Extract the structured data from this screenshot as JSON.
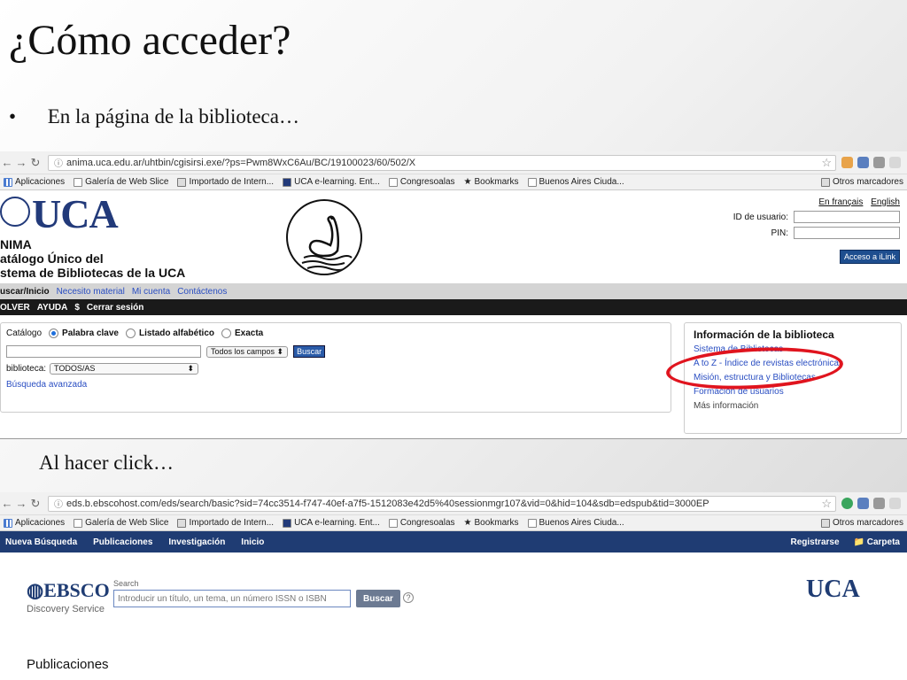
{
  "slide": {
    "title": "¿Cómo acceder?",
    "bullet": "En la página de la biblioteca…",
    "caption": "Al hacer click…"
  },
  "browser1": {
    "url": "anima.uca.edu.ar/uhtbin/cgisirsi.exe/?ps=Pwm8WxC6Au/BC/19100023/60/502/X",
    "bookmarks": [
      "Aplicaciones",
      "Galería de Web Slice",
      "Importado de Intern...",
      "UCA e-learning. Ent...",
      "Congresoalas",
      "Bookmarks",
      "Buenos Aires Ciuda..."
    ],
    "other_bookmarks": "Otros marcadores"
  },
  "uca": {
    "logo": "UCA",
    "lines": [
      "NIMA",
      "atálogo Único del",
      "stema de Bibliotecas de la UCA"
    ],
    "lang_fr": "En français",
    "lang_en": "English",
    "user_label": "ID de usuario:",
    "pin_label": "PIN:",
    "ilink_button": "Acceso a iLink",
    "nav": {
      "current": "uscar/Inicio",
      "links": [
        "Necesito material",
        "Mi cuenta",
        "Contáctenos"
      ]
    },
    "black_bar": [
      "OLVER",
      "AYUDA",
      "$",
      "Cerrar sesión"
    ],
    "search": {
      "catalog_label": "Catálogo",
      "options": [
        "Palabra clave",
        "Listado alfabético",
        "Exacta"
      ],
      "fields_select": "Todos los campos",
      "search_button": "Buscar",
      "library_label": "biblioteca:",
      "library_value": "TODOS/AS",
      "advanced": "Búsqueda avanzada"
    },
    "info": {
      "title": "Información de la biblioteca",
      "links": [
        "Sistema de Bibliotecas",
        "A to Z - Índice de revistas electrónicas",
        "Misión, estructura y Bibliotecas",
        "Formación de usuarios"
      ],
      "more": "Más información"
    }
  },
  "browser2": {
    "url": "eds.b.ebscohost.com/eds/search/basic?sid=74cc3514-f747-40ef-a7f5-1512083e42d5%40sessionmgr107&vid=0&hid=104&sdb=edspub&tid=3000EP",
    "bookmarks": [
      "Aplicaciones",
      "Galería de Web Slice",
      "Importado de Intern...",
      "UCA e-learning. Ent...",
      "Congresoalas",
      "Bookmarks",
      "Buenos Aires Ciuda..."
    ],
    "other_bookmarks": "Otros marcadores"
  },
  "ebsco": {
    "nav": [
      "Nueva Búsqueda",
      "Publicaciones",
      "Investigación",
      "Inicio"
    ],
    "nav_right": [
      "Registrarse",
      "Carpeta"
    ],
    "logo": "EBSCO",
    "logo_sub": "Discovery Service",
    "search_label": "Search",
    "placeholder": "Introducir un título, un tema, un número ISSN o ISBN",
    "search_button": "Buscar",
    "uca_logo": "UCA",
    "section_title": "Publicaciones"
  }
}
